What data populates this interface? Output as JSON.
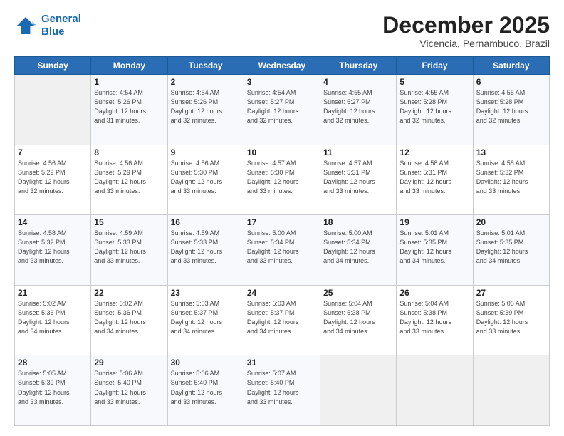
{
  "logo": {
    "line1": "General",
    "line2": "Blue"
  },
  "header": {
    "month": "December 2025",
    "location": "Vicencia, Pernambuco, Brazil"
  },
  "weekdays": [
    "Sunday",
    "Monday",
    "Tuesday",
    "Wednesday",
    "Thursday",
    "Friday",
    "Saturday"
  ],
  "weeks": [
    [
      {
        "day": "",
        "info": ""
      },
      {
        "day": "1",
        "info": "Sunrise: 4:54 AM\nSunset: 5:26 PM\nDaylight: 12 hours\nand 31 minutes."
      },
      {
        "day": "2",
        "info": "Sunrise: 4:54 AM\nSunset: 5:26 PM\nDaylight: 12 hours\nand 32 minutes."
      },
      {
        "day": "3",
        "info": "Sunrise: 4:54 AM\nSunset: 5:27 PM\nDaylight: 12 hours\nand 32 minutes."
      },
      {
        "day": "4",
        "info": "Sunrise: 4:55 AM\nSunset: 5:27 PM\nDaylight: 12 hours\nand 32 minutes."
      },
      {
        "day": "5",
        "info": "Sunrise: 4:55 AM\nSunset: 5:28 PM\nDaylight: 12 hours\nand 32 minutes."
      },
      {
        "day": "6",
        "info": "Sunrise: 4:55 AM\nSunset: 5:28 PM\nDaylight: 12 hours\nand 32 minutes."
      }
    ],
    [
      {
        "day": "7",
        "info": "Sunrise: 4:56 AM\nSunset: 5:29 PM\nDaylight: 12 hours\nand 32 minutes."
      },
      {
        "day": "8",
        "info": "Sunrise: 4:56 AM\nSunset: 5:29 PM\nDaylight: 12 hours\nand 33 minutes."
      },
      {
        "day": "9",
        "info": "Sunrise: 4:56 AM\nSunset: 5:30 PM\nDaylight: 12 hours\nand 33 minutes."
      },
      {
        "day": "10",
        "info": "Sunrise: 4:57 AM\nSunset: 5:30 PM\nDaylight: 12 hours\nand 33 minutes."
      },
      {
        "day": "11",
        "info": "Sunrise: 4:57 AM\nSunset: 5:31 PM\nDaylight: 12 hours\nand 33 minutes."
      },
      {
        "day": "12",
        "info": "Sunrise: 4:58 AM\nSunset: 5:31 PM\nDaylight: 12 hours\nand 33 minutes."
      },
      {
        "day": "13",
        "info": "Sunrise: 4:58 AM\nSunset: 5:32 PM\nDaylight: 12 hours\nand 33 minutes."
      }
    ],
    [
      {
        "day": "14",
        "info": "Sunrise: 4:58 AM\nSunset: 5:32 PM\nDaylight: 12 hours\nand 33 minutes."
      },
      {
        "day": "15",
        "info": "Sunrise: 4:59 AM\nSunset: 5:33 PM\nDaylight: 12 hours\nand 33 minutes."
      },
      {
        "day": "16",
        "info": "Sunrise: 4:59 AM\nSunset: 5:33 PM\nDaylight: 12 hours\nand 33 minutes."
      },
      {
        "day": "17",
        "info": "Sunrise: 5:00 AM\nSunset: 5:34 PM\nDaylight: 12 hours\nand 33 minutes."
      },
      {
        "day": "18",
        "info": "Sunrise: 5:00 AM\nSunset: 5:34 PM\nDaylight: 12 hours\nand 34 minutes."
      },
      {
        "day": "19",
        "info": "Sunrise: 5:01 AM\nSunset: 5:35 PM\nDaylight: 12 hours\nand 34 minutes."
      },
      {
        "day": "20",
        "info": "Sunrise: 5:01 AM\nSunset: 5:35 PM\nDaylight: 12 hours\nand 34 minutes."
      }
    ],
    [
      {
        "day": "21",
        "info": "Sunrise: 5:02 AM\nSunset: 5:36 PM\nDaylight: 12 hours\nand 34 minutes."
      },
      {
        "day": "22",
        "info": "Sunrise: 5:02 AM\nSunset: 5:36 PM\nDaylight: 12 hours\nand 34 minutes."
      },
      {
        "day": "23",
        "info": "Sunrise: 5:03 AM\nSunset: 5:37 PM\nDaylight: 12 hours\nand 34 minutes."
      },
      {
        "day": "24",
        "info": "Sunrise: 5:03 AM\nSunset: 5:37 PM\nDaylight: 12 hours\nand 34 minutes."
      },
      {
        "day": "25",
        "info": "Sunrise: 5:04 AM\nSunset: 5:38 PM\nDaylight: 12 hours\nand 34 minutes."
      },
      {
        "day": "26",
        "info": "Sunrise: 5:04 AM\nSunset: 5:38 PM\nDaylight: 12 hours\nand 33 minutes."
      },
      {
        "day": "27",
        "info": "Sunrise: 5:05 AM\nSunset: 5:39 PM\nDaylight: 12 hours\nand 33 minutes."
      }
    ],
    [
      {
        "day": "28",
        "info": "Sunrise: 5:05 AM\nSunset: 5:39 PM\nDaylight: 12 hours\nand 33 minutes."
      },
      {
        "day": "29",
        "info": "Sunrise: 5:06 AM\nSunset: 5:40 PM\nDaylight: 12 hours\nand 33 minutes."
      },
      {
        "day": "30",
        "info": "Sunrise: 5:06 AM\nSunset: 5:40 PM\nDaylight: 12 hours\nand 33 minutes."
      },
      {
        "day": "31",
        "info": "Sunrise: 5:07 AM\nSunset: 5:40 PM\nDaylight: 12 hours\nand 33 minutes."
      },
      {
        "day": "",
        "info": ""
      },
      {
        "day": "",
        "info": ""
      },
      {
        "day": "",
        "info": ""
      }
    ]
  ]
}
